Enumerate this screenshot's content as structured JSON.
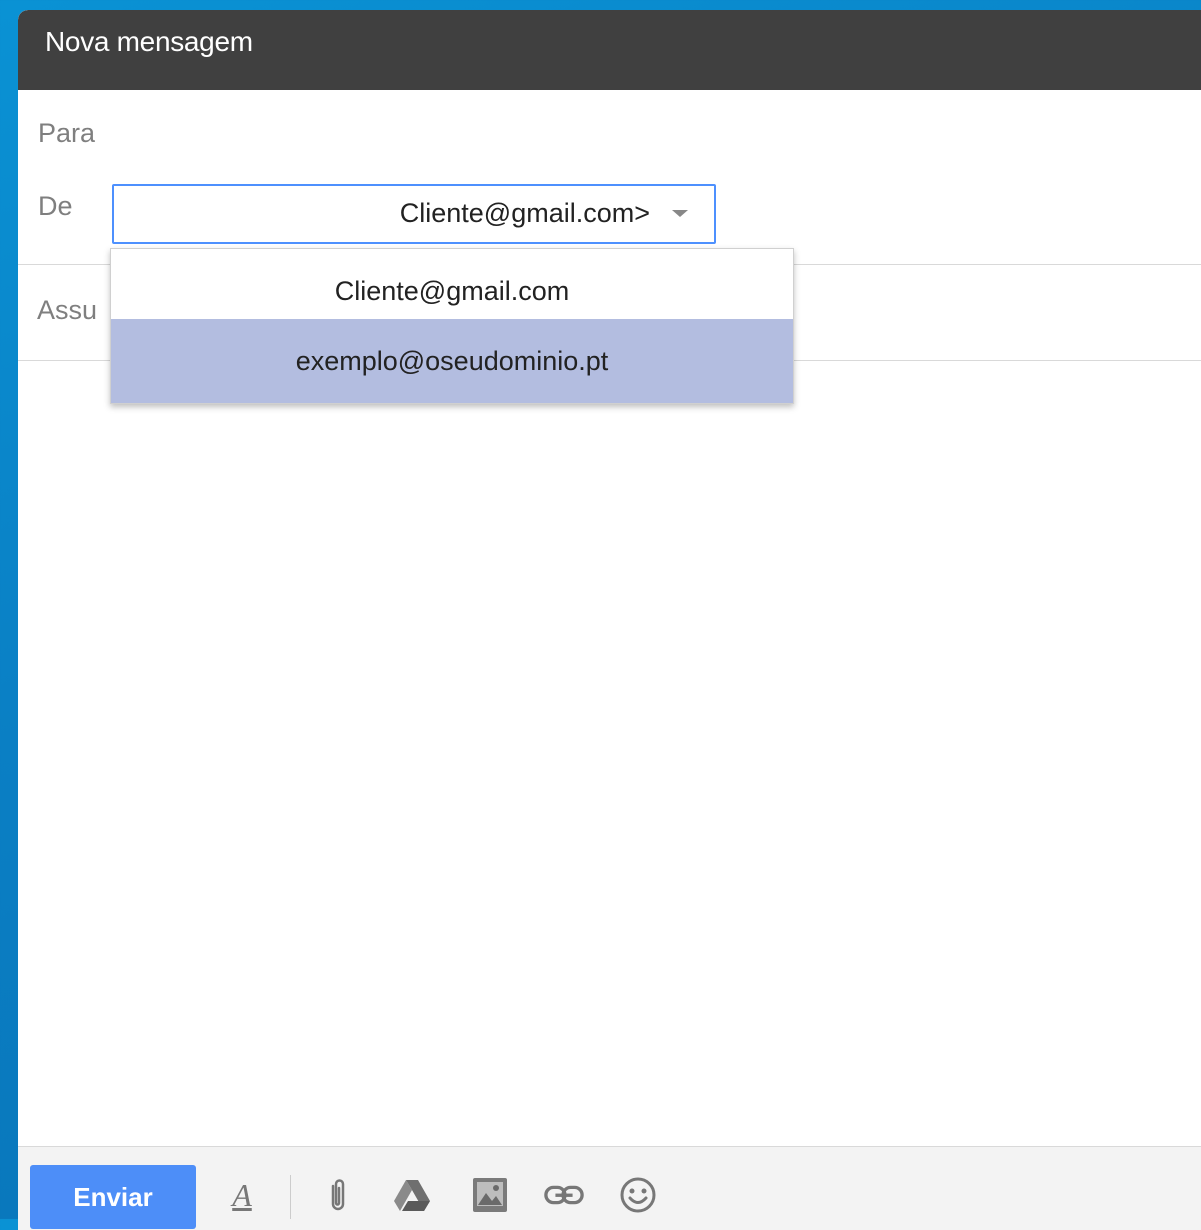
{
  "window": {
    "title": "Nova mensagem"
  },
  "fields": {
    "to_label": "Para",
    "from_label": "De",
    "subject_label_partial": "Assu"
  },
  "from_select": {
    "value": "Cliente@gmail.com>",
    "options": [
      "Cliente@gmail.com",
      "exemplo@oseudominio.pt"
    ],
    "highlighted_option": "exemplo@oseudominio.pt"
  },
  "toolbar": {
    "send_label": "Enviar",
    "format_label": "A",
    "icons": [
      "format-text-icon",
      "attach-icon",
      "drive-icon",
      "insert-photo-icon",
      "insert-link-icon",
      "emoji-icon"
    ]
  },
  "colors": {
    "titlebar": "#404040",
    "send_button": "#4d8ef8",
    "highlight": "#b3bde0",
    "focus_border": "#4d90fe"
  }
}
